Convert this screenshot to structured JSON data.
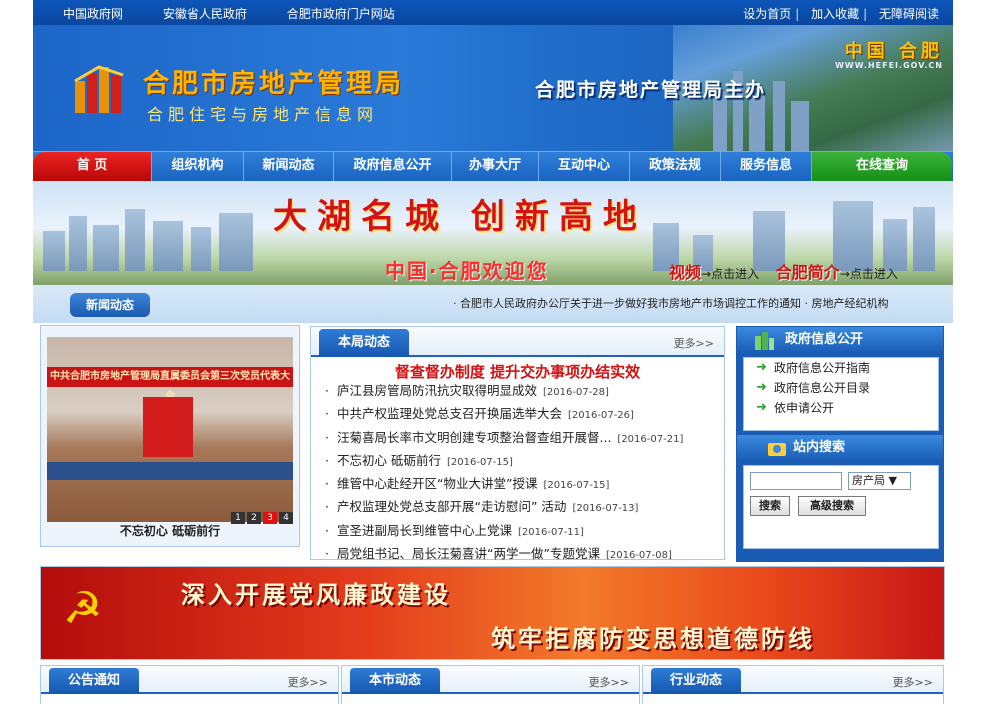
{
  "topbar": {
    "links": [
      "中国政府网",
      "安徽省人民政府",
      "合肥市政府门户网站"
    ],
    "right": [
      "设为首页",
      "加入收藏",
      "无障碍阅读"
    ]
  },
  "header": {
    "title": "合肥市房地产管理局",
    "subtitle": "合肥住宅与房地产信息网",
    "host": "合肥市房地产管理局主办",
    "city": "中国 合肥",
    "web_address": "WWW.HEFEI.GOV.CN"
  },
  "nav": [
    "首 页",
    "组织机构",
    "新闻动态",
    "政府信息公开",
    "办事大厅",
    "互动中心",
    "政策法规",
    "服务信息",
    "在线查询"
  ],
  "banner": {
    "slogan": "大湖名城 创新高地",
    "welcome": "中国·合肥欢迎您",
    "video": "视频",
    "video_enter": "→点击进入",
    "intro": "合肥简介",
    "intro_enter": "→点击进入"
  },
  "newsstrip": {
    "tag": "新闻动态",
    "marquee": "· 合肥市人民政府办公厅关于进一步做好我市房地产市场调控工作的通知 · 房地产经纪机构"
  },
  "photo": {
    "banner_text": "中共合肥市房地产管理局直属委员会第三次党员代表大会",
    "caption": "不忘初心  砥砺前行",
    "pages": [
      "1",
      "2",
      "3",
      "4"
    ],
    "active_page": "3"
  },
  "local_news": {
    "tab": "本局动态",
    "more": "更多>>",
    "headline": "督查督办制度  提升交办事项办结实效",
    "items": [
      {
        "title": "庐江县房管局防汛抗灾取得明显成效",
        "date": "[2016-07-28]"
      },
      {
        "title": "中共产权监理处党总支召开换届选举大会",
        "date": "[2016-07-26]"
      },
      {
        "title": "汪菊喜局长率市文明创建专项整治督查组开展督...",
        "date": "[2016-07-21]"
      },
      {
        "title": "不忘初心  砥砺前行",
        "date": "[2016-07-15]"
      },
      {
        "title": "维管中心赴经开区“物业大讲堂”授课",
        "date": "[2016-07-15]"
      },
      {
        "title": "产权监理处党总支部开展“走访慰问” 活动",
        "date": "[2016-07-13]"
      },
      {
        "title": "宣圣进副局长到维管中心上党课",
        "date": "[2016-07-11]"
      },
      {
        "title": "局党组书记、局长汪菊喜讲“两学一做”专题党课",
        "date": "[2016-07-08]"
      }
    ]
  },
  "gov_panel": {
    "title": "政府信息公开",
    "links": [
      "政府信息公开指南",
      "政府信息公开目录",
      "依申请公开"
    ],
    "search_title": "站内搜索",
    "select_value": "房产局",
    "search_btn": "搜索",
    "advanced_btn": "高级搜索"
  },
  "party_band": {
    "line1": "深入开展党风廉政建设",
    "line2": "筑牢拒腐防变思想道德防线"
  },
  "bottom_sections": [
    {
      "tab": "公告通知",
      "more": "更多>>"
    },
    {
      "tab": "本市动态",
      "more": "更多>>"
    },
    {
      "tab": "行业动态",
      "more": "更多>>"
    }
  ],
  "colors": {
    "brand_blue": "#1a5cb4",
    "accent_red": "#d31212",
    "nav_green": "#158e15"
  }
}
